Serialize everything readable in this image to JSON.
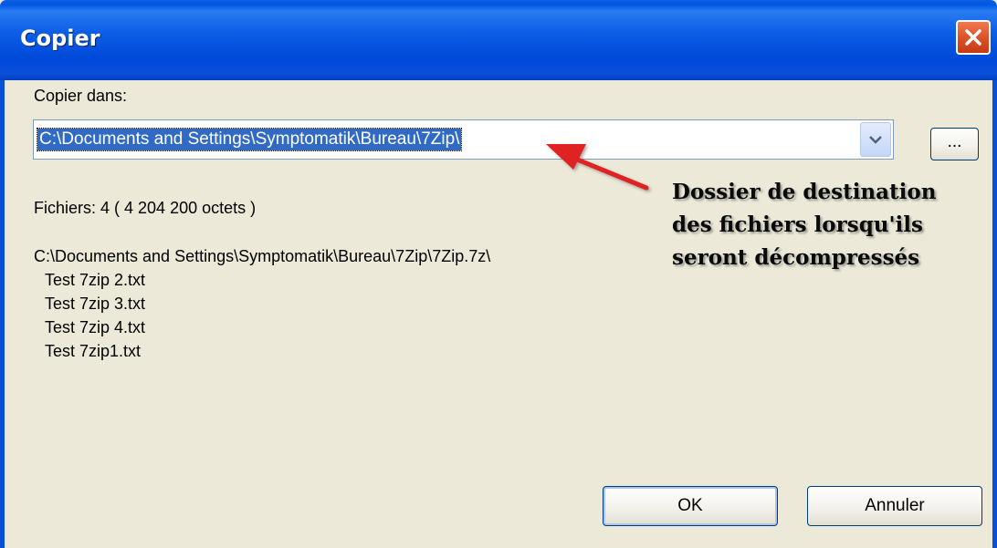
{
  "window": {
    "title": "Copier",
    "close_icon": "close-icon"
  },
  "dialog": {
    "destination_label": "Copier dans:",
    "destination_path": "C:\\Documents and Settings\\Symptomatik\\Bureau\\7Zip\\",
    "dropdown_icon": "chevron-down-icon",
    "browse_label": "...",
    "files_label": "Fichiers: 4    ( 4 204 200 octets )",
    "archive_path": "C:\\Documents and Settings\\Symptomatik\\Bureau\\7Zip\\7Zip.7z\\",
    "files": [
      "Test 7zip 2.txt",
      "Test 7zip 3.txt",
      "Test 7zip 4.txt",
      "Test 7zip1.txt"
    ],
    "ok_label": "OK",
    "cancel_label": "Annuler"
  },
  "annotation": {
    "lines": [
      "Dossier de destination",
      "des fichiers lorsqu'ils",
      "seront décompressés"
    ],
    "arrow_color": "#e02020"
  },
  "colors": {
    "titlebar": "#0054e3",
    "dialog_bg": "#ece9d8",
    "selection": "#316ac5",
    "close_button": "#e0552c"
  }
}
